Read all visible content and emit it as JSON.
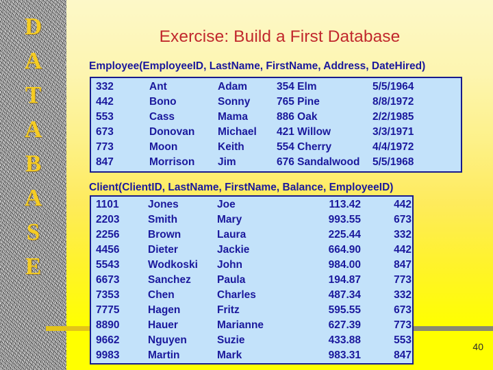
{
  "slide": {
    "title": "Exercise: Build a First Database",
    "page_number": "40",
    "title_color": "#c1282d",
    "text_color": "#1a189c",
    "box_fill": "#c3e2fa",
    "box_border": "#181a8c",
    "accent_gold": "#e3c419",
    "accent_gray": "#8a8a70"
  },
  "sidebar": {
    "letters": [
      "D",
      "A",
      "T",
      "A",
      "B",
      "A",
      "S",
      "E"
    ],
    "word": "DATABASE",
    "letter_color": "#f5cc22"
  },
  "employee": {
    "caption": "Employee(EmployeeID, LastName, FirstName, Address, DateHired)",
    "columns": [
      "EmployeeID",
      "LastName",
      "FirstName",
      "Address",
      "DateHired"
    ],
    "rows": [
      [
        "332",
        "Ant",
        "Adam",
        "354 Elm",
        "5/5/1964"
      ],
      [
        "442",
        "Bono",
        "Sonny",
        "765 Pine",
        "8/8/1972"
      ],
      [
        "553",
        "Cass",
        "Mama",
        "886 Oak",
        "2/2/1985"
      ],
      [
        "673",
        "Donovan",
        "Michael",
        "421 Willow",
        "3/3/1971"
      ],
      [
        "773",
        "Moon",
        "Keith",
        "554 Cherry",
        "4/4/1972"
      ],
      [
        "847",
        "Morrison",
        "Jim",
        "676 Sandalwood",
        "5/5/1968"
      ]
    ]
  },
  "client": {
    "caption": "Client(ClientID, LastName, FirstName, Balance, EmployeeID)",
    "columns": [
      "ClientID",
      "LastName",
      "FirstName",
      "Balance",
      "EmployeeID"
    ],
    "rows": [
      [
        "1101",
        "Jones",
        "Joe",
        "113.42",
        "442"
      ],
      [
        "2203",
        "Smith",
        "Mary",
        "993.55",
        "673"
      ],
      [
        "2256",
        "Brown",
        "Laura",
        "225.44",
        "332"
      ],
      [
        "4456",
        "Dieter",
        "Jackie",
        "664.90",
        "442"
      ],
      [
        "5543",
        "Wodkoski",
        "John",
        "984.00",
        "847"
      ],
      [
        "6673",
        "Sanchez",
        "Paula",
        "194.87",
        "773"
      ],
      [
        "7353",
        "Chen",
        "Charles",
        "487.34",
        "332"
      ],
      [
        "7775",
        "Hagen",
        "Fritz",
        "595.55",
        "673"
      ],
      [
        "8890",
        "Hauer",
        "Marianne",
        "627.39",
        "773"
      ],
      [
        "9662",
        "Nguyen",
        "Suzie",
        "433.88",
        "553"
      ],
      [
        "9983",
        "Martin",
        "Mark",
        "983.31",
        "847"
      ]
    ]
  }
}
